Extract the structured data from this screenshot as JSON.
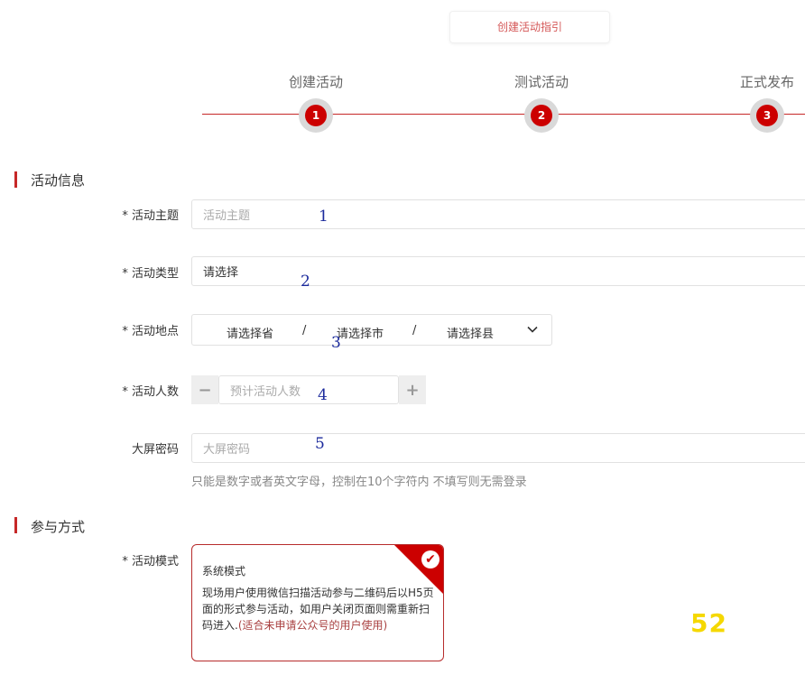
{
  "guide": {
    "label": "创建活动指引"
  },
  "steps": [
    {
      "label": "创建活动",
      "number": "1"
    },
    {
      "label": "测试活动",
      "number": "2"
    },
    {
      "label": "正式发布",
      "number": "3"
    }
  ],
  "section_info": {
    "title": "活动信息"
  },
  "fields": {
    "theme": {
      "label": "* 活动主题",
      "placeholder": "活动主题",
      "marker": "1"
    },
    "type": {
      "label": "* 活动类型",
      "value": "请选择",
      "marker": "2"
    },
    "location": {
      "label": "* 活动地点",
      "province": "请选择省",
      "city": "请选择市",
      "county": "请选择县",
      "sep": "/",
      "marker": "3"
    },
    "count": {
      "label": "* 活动人数",
      "placeholder": "预计活动人数",
      "minus": "−",
      "plus": "+",
      "marker": "4"
    },
    "password": {
      "label": "大屏密码",
      "placeholder": "大屏密码",
      "marker": "5",
      "hint": "只能是数字或者英文字母，控制在10个字符内 不填写则无需登录"
    }
  },
  "section_join": {
    "title": "参与方式"
  },
  "mode": {
    "label": "* 活动模式",
    "card_title": "系统模式",
    "desc_main": "现场用户使用微信扫描活动参与二维码后以H5页面的形式参与活动，如用户关闭页面则需重新扫码进入.",
    "desc_highlight": "(适合未申请公众号的用户使用)",
    "check": "✔"
  },
  "watermark": {
    "text": "52"
  },
  "colors": {
    "accent": "#c62828",
    "marker": "#1b2a9c"
  }
}
